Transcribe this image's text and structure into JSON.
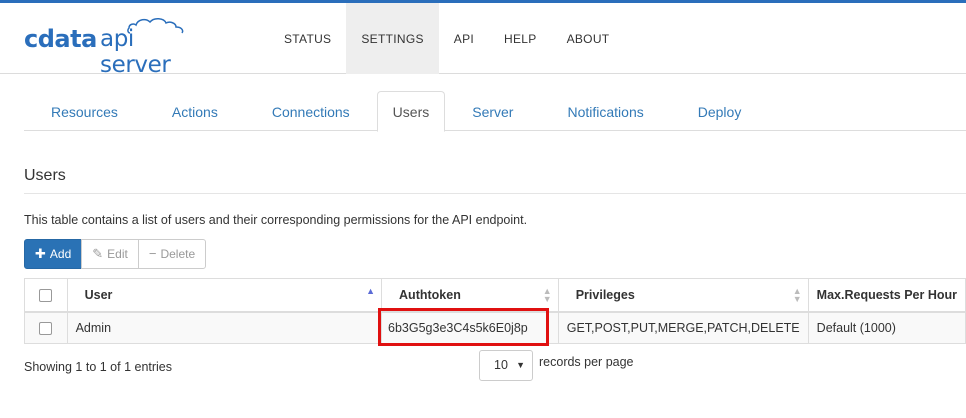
{
  "app": {
    "logo_brand": "cdata",
    "logo_product": "api server",
    "brand_color": "#2a6ebb"
  },
  "nav": {
    "items": [
      {
        "label": "STATUS",
        "active": false
      },
      {
        "label": "SETTINGS",
        "active": true
      },
      {
        "label": "API",
        "active": false
      },
      {
        "label": "HELP",
        "active": false
      },
      {
        "label": "ABOUT",
        "active": false
      }
    ]
  },
  "tabs": [
    {
      "label": "Resources",
      "active": false
    },
    {
      "label": "Actions",
      "active": false
    },
    {
      "label": "Connections",
      "active": false
    },
    {
      "label": "Users",
      "active": true
    },
    {
      "label": "Server",
      "active": false
    },
    {
      "label": "Notifications",
      "active": false
    },
    {
      "label": "Deploy",
      "active": false
    }
  ],
  "section": {
    "title": "Users",
    "description": "This table contains a list of users and their corresponding permissions for the API endpoint."
  },
  "toolbar": {
    "add": {
      "label": "Add",
      "icon": "plus-icon"
    },
    "edit": {
      "label": "Edit",
      "icon": "edit-icon"
    },
    "delete": {
      "label": "Delete",
      "icon": "minus-icon"
    }
  },
  "table": {
    "columns": [
      "User",
      "Authtoken",
      "Privileges",
      "Max.Requests Per Hour"
    ],
    "rows": [
      {
        "user": "Admin",
        "authtoken": "6b3G5g3e3C4s5k6E0j8p",
        "privileges": "GET,POST,PUT,MERGE,PATCH,DELETE",
        "max_requests": "Default (1000)"
      }
    ],
    "highlight_color": "#e01010"
  },
  "footer": {
    "showing": "Showing 1 to 1 of 1 entries",
    "page_size": "10",
    "per_page_label": "records per page"
  }
}
